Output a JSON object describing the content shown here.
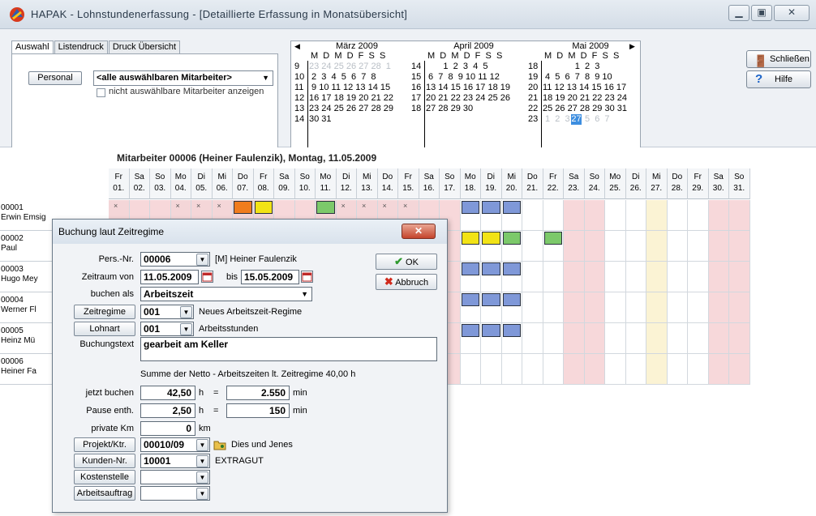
{
  "window": {
    "title": "HAPAK - Lohnstundenerfassung - [Detaillierte Erfassung in Monatsübersicht]"
  },
  "tabs": [
    "Auswahl",
    "Listendruck",
    "Druck Übersicht"
  ],
  "selection": {
    "personal_button": "Personal",
    "employee_dropdown": "<alle auswählbaren Mitarbeiter>",
    "checkbox_label": "nicht auswählbare Mitarbeiter anzeigen"
  },
  "calendar": {
    "months": [
      {
        "name": "März 2009",
        "weeks": [
          "9",
          "10",
          "11",
          "12",
          "13",
          "14"
        ],
        "rows": [
          "23 24 25 26 27 28  1",
          " 2  3  4  5  6  7  8",
          " 9 10 11 12 13 14 15",
          "16 17 18 19 20 21 22",
          "23 24 25 26 27 28 29",
          "30 31"
        ]
      },
      {
        "name": "April 2009",
        "weeks": [
          "14",
          "15",
          "16",
          "17",
          "18",
          ""
        ],
        "rows": [
          "       1  2  3  4  5",
          " 6  7  8  9 10 11 12",
          "13 14 15 16 17 18 19",
          "20 21 22 23 24 25 26",
          "27 28 29 30",
          ""
        ]
      },
      {
        "name": "Mai 2009",
        "weeks": [
          "18",
          "19",
          "20",
          "21",
          "22",
          "23"
        ],
        "rows": [
          "             1  2  3",
          " 4  5  6  7  8  9 10",
          "11 12 13 14 15 16 17",
          "18 19 20 21 22 23 24",
          "25 26 27 28 29 30 31",
          " 1  2  3  4  5  6  7"
        ]
      }
    ],
    "weekday_header": "M  D  M  D  F  S  S",
    "selected_day": "27"
  },
  "right_buttons": {
    "close": "Schließen",
    "help": "Hilfe"
  },
  "grid": {
    "header": "Mitarbeiter 00006 (Heiner Faulenzik), Montag, 11.05.2009",
    "days": [
      {
        "wd": "Fr",
        "d": "01."
      },
      {
        "wd": "Sa",
        "d": "02."
      },
      {
        "wd": "So",
        "d": "03."
      },
      {
        "wd": "Mo",
        "d": "04."
      },
      {
        "wd": "Di",
        "d": "05."
      },
      {
        "wd": "Mi",
        "d": "06."
      },
      {
        "wd": "Do",
        "d": "07."
      },
      {
        "wd": "Fr",
        "d": "08."
      },
      {
        "wd": "Sa",
        "d": "09."
      },
      {
        "wd": "So",
        "d": "10."
      },
      {
        "wd": "Mo",
        "d": "11."
      },
      {
        "wd": "Di",
        "d": "12."
      },
      {
        "wd": "Mi",
        "d": "13."
      },
      {
        "wd": "Do",
        "d": "14."
      },
      {
        "wd": "Fr",
        "d": "15."
      },
      {
        "wd": "Sa",
        "d": "16."
      },
      {
        "wd": "So",
        "d": "17."
      },
      {
        "wd": "Mo",
        "d": "18."
      },
      {
        "wd": "Di",
        "d": "19."
      },
      {
        "wd": "Mi",
        "d": "20."
      },
      {
        "wd": "Do",
        "d": "21."
      },
      {
        "wd": "Fr",
        "d": "22."
      },
      {
        "wd": "Sa",
        "d": "23."
      },
      {
        "wd": "So",
        "d": "24."
      },
      {
        "wd": "Mo",
        "d": "25."
      },
      {
        "wd": "Di",
        "d": "26."
      },
      {
        "wd": "Mi",
        "d": "27."
      },
      {
        "wd": "Do",
        "d": "28."
      },
      {
        "wd": "Fr",
        "d": "29."
      },
      {
        "wd": "Sa",
        "d": "30."
      },
      {
        "wd": "So",
        "d": "31."
      }
    ],
    "employees": [
      {
        "nr": "00001",
        "name": "Erwin Emsig"
      },
      {
        "nr": "00002",
        "name": "Paul"
      },
      {
        "nr": "00003",
        "name": "Hugo Mey"
      },
      {
        "nr": "00004",
        "name": "Werner Fl"
      },
      {
        "nr": "00005",
        "name": "Heinz Mü"
      },
      {
        "nr": "00006",
        "name": "Heiner Fa"
      }
    ],
    "colors": {
      "weekend": "#f7d8da",
      "holiday": "#fbf3d4",
      "blue": "#7f98d8",
      "yellow": "#f2e316",
      "green": "#7cc96a",
      "orange": "#f07c1e"
    }
  },
  "dialog": {
    "title": "Buchung laut Zeitregime",
    "pers_label": "Pers.-Nr.",
    "pers_value": "00006",
    "pers_name": "[M] Heiner Faulenzik",
    "zeitraum_label": "Zeitraum von",
    "from_date": "11.05.2009",
    "bis_label": "bis",
    "to_date": "15.05.2009",
    "buchen_als_label": "buchen als",
    "buchen_als_value": "Arbeitszeit",
    "zeitregime_btn": "Zeitregime",
    "zeitregime_value": "001",
    "zeitregime_text": "Neues Arbeitszeit-Regime",
    "lohnart_btn": "Lohnart",
    "lohnart_value": "001",
    "lohnart_text": "Arbeitsstunden",
    "buchungstext_label": "Buchungstext",
    "buchungstext_value": "gearbeit am Keller",
    "summe_text": "Summe der Netto - Arbeitszeiten lt. Zeitregime 40,00 h",
    "jetzt_label": "jetzt buchen",
    "jetzt_h": "42,50",
    "jetzt_min": "2.550",
    "pause_label": "Pause enth.",
    "pause_h": "2,50",
    "pause_min": "150",
    "km_label": "private Km",
    "km_value": "0",
    "unit_h": "h",
    "unit_eq": "=",
    "unit_min": "min",
    "unit_km": "km",
    "projekt_btn": "Projekt/Ktr.",
    "projekt_value": "00010/09",
    "projekt_text": "Dies und Jenes",
    "kunden_btn": "Kunden-Nr.",
    "kunden_value": "10001",
    "kunden_text": "EXTRAGUT",
    "kosten_btn": "Kostenstelle",
    "auftrag_btn": "Arbeitsauftrag",
    "ok": "OK",
    "abbruch": "Abbruch"
  }
}
